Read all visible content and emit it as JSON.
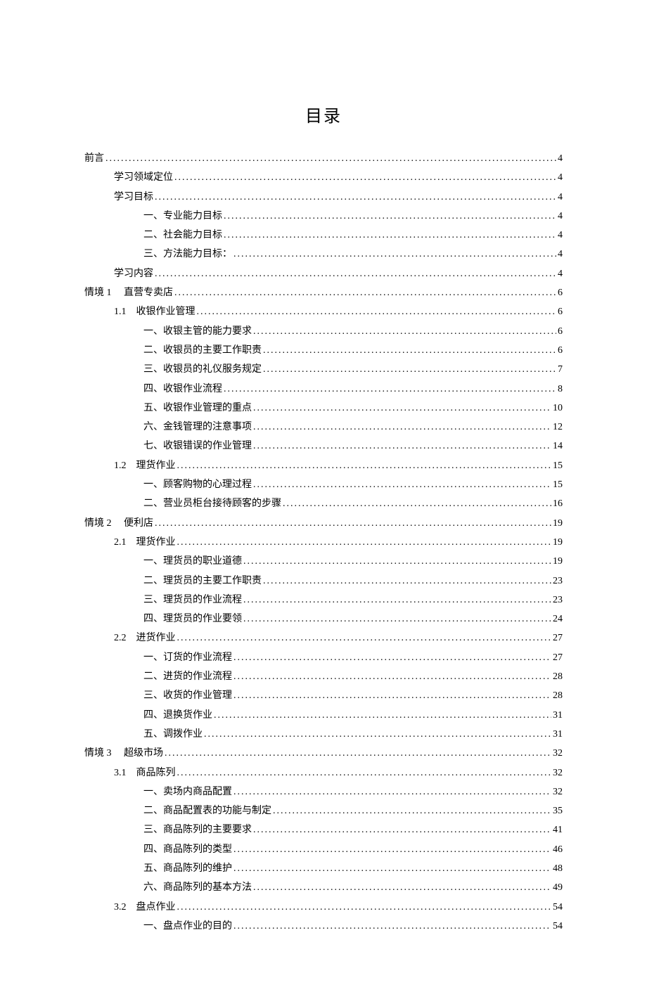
{
  "title": "目录",
  "entries": [
    {
      "indent": 0,
      "label": "前言",
      "page": "4"
    },
    {
      "indent": 1,
      "label": "学习领域定位",
      "page": "4"
    },
    {
      "indent": 1,
      "label": "学习目标",
      "page": "4"
    },
    {
      "indent": 2,
      "label": "一、专业能力目标",
      "page": "4"
    },
    {
      "indent": 2,
      "label": "二、社会能力目标",
      "page": "4"
    },
    {
      "indent": 2,
      "label": "三、方法能力目标：",
      "page": "4"
    },
    {
      "indent": 1,
      "label": "学习内容",
      "page": "4"
    },
    {
      "indent": 0,
      "label": "情境 1　 直营专卖店",
      "page": "6"
    },
    {
      "indent": 1,
      "label": "1.1　收银作业管理",
      "page": "6"
    },
    {
      "indent": 2,
      "label": "一、收银主管的能力要求",
      "page": "6"
    },
    {
      "indent": 2,
      "label": "二、收银员的主要工作职责",
      "page": "6"
    },
    {
      "indent": 2,
      "label": "三、收银员的礼仪服务规定",
      "page": "7"
    },
    {
      "indent": 2,
      "label": "四、收银作业流程",
      "page": "8"
    },
    {
      "indent": 2,
      "label": "五、收银作业管理的重点",
      "page": "10"
    },
    {
      "indent": 2,
      "label": "六、金钱管理的注意事项",
      "page": "12"
    },
    {
      "indent": 2,
      "label": "七、收银错误的作业管理",
      "page": "14"
    },
    {
      "indent": 1,
      "label": "1.2　理货作业",
      "page": "15"
    },
    {
      "indent": 2,
      "label": "一、顾客购物的心理过程",
      "page": "15"
    },
    {
      "indent": 2,
      "label": "二、营业员柜台接待顾客的步骤",
      "page": "16"
    },
    {
      "indent": 0,
      "label": "情境 2　 便利店",
      "page": "19"
    },
    {
      "indent": 1,
      "label": "2.1　理货作业",
      "page": "19"
    },
    {
      "indent": 2,
      "label": "一、理货员的职业道德",
      "page": "19"
    },
    {
      "indent": 2,
      "label": "二、理货员的主要工作职责",
      "page": "23"
    },
    {
      "indent": 2,
      "label": "三、理货员的作业流程",
      "page": "23"
    },
    {
      "indent": 2,
      "label": "四、理货员的作业要领",
      "page": "24"
    },
    {
      "indent": 1,
      "label": "2.2　进货作业",
      "page": "27"
    },
    {
      "indent": 2,
      "label": "一、订货的作业流程",
      "page": "27"
    },
    {
      "indent": 2,
      "label": "二、进货的作业流程",
      "page": "28"
    },
    {
      "indent": 2,
      "label": "三、收货的作业管理",
      "page": "28"
    },
    {
      "indent": 2,
      "label": "四、退换货作业",
      "page": "31"
    },
    {
      "indent": 2,
      "label": "五、调拨作业",
      "page": "31"
    },
    {
      "indent": 0,
      "label": "情境 3　 超级市场",
      "page": "32"
    },
    {
      "indent": 1,
      "label": "3.1　商品陈列",
      "page": "32"
    },
    {
      "indent": 2,
      "label": "一、卖场内商品配置",
      "page": "32"
    },
    {
      "indent": 2,
      "label": "二、商品配置表的功能与制定",
      "page": "35"
    },
    {
      "indent": 2,
      "label": "三、商品陈列的主要要求",
      "page": "41"
    },
    {
      "indent": 2,
      "label": "四、商品陈列的类型",
      "page": "46"
    },
    {
      "indent": 2,
      "label": "五、商品陈列的维护",
      "page": "48"
    },
    {
      "indent": 2,
      "label": "六、商品陈列的基本方法",
      "page": "49"
    },
    {
      "indent": 1,
      "label": "3.2　盘点作业",
      "page": "54"
    },
    {
      "indent": 2,
      "label": "一、盘点作业的目的",
      "page": "54"
    }
  ]
}
